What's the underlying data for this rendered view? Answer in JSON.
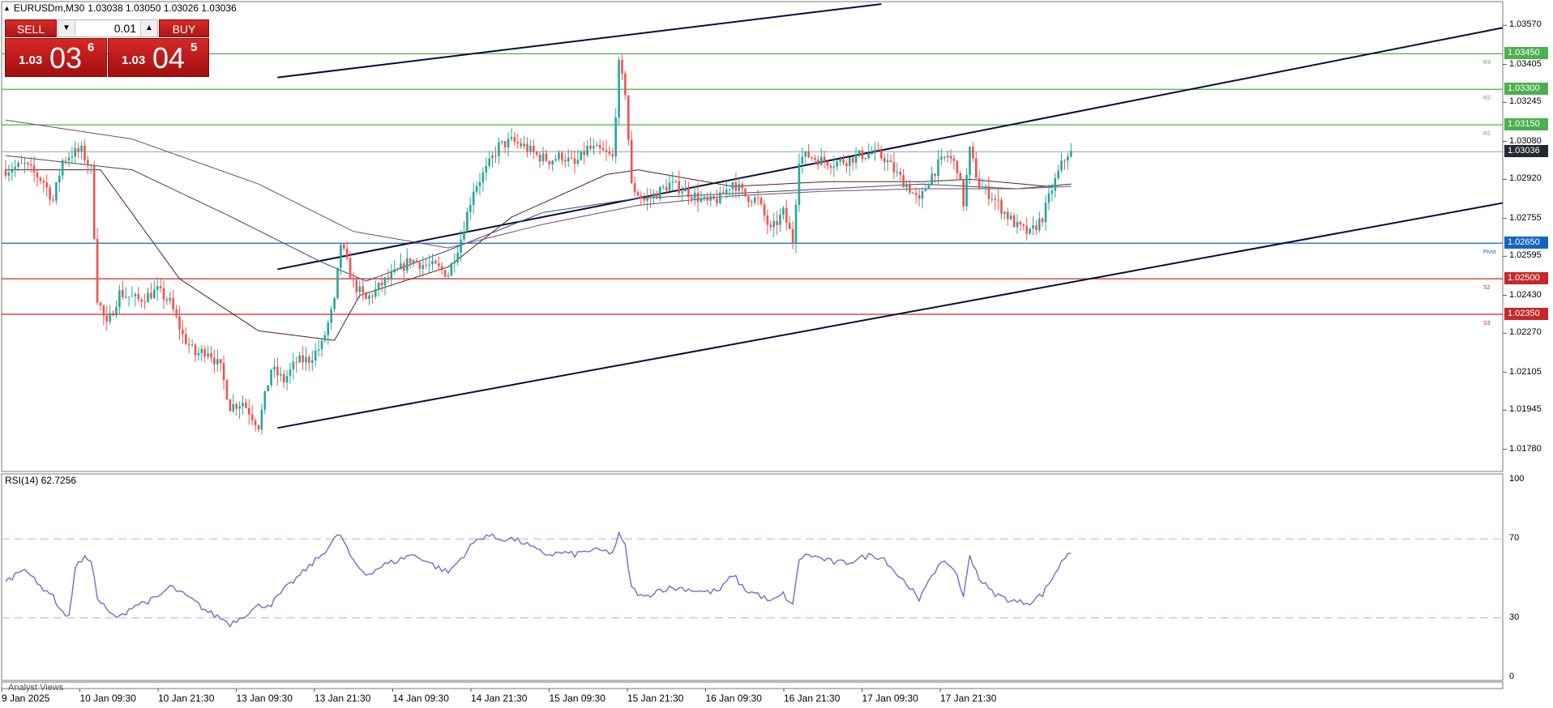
{
  "header": {
    "symbol": "EURUSDm,M30",
    "ohlc": "1.03038 1.03050 1.03026 1.03036"
  },
  "trade_panel": {
    "sell_label": "SELL",
    "buy_label": "BUY",
    "lot": "0.01",
    "sell_small": "1.03",
    "sell_big": "03",
    "sell_sup": "6",
    "buy_small": "1.03",
    "buy_big": "04",
    "buy_sup": "5",
    "arrow_down": "▼",
    "arrow_up": "▲"
  },
  "chart_data": [
    {
      "type": "candlestick",
      "title": "EURUSDm,M30",
      "ylim": [
        1.017,
        1.0366
      ],
      "y_ticks": [
        "1.03570",
        "1.03405",
        "1.03245",
        "1.03080",
        "1.02920",
        "1.02755",
        "1.02595",
        "1.02430",
        "1.02270",
        "1.02105",
        "1.01945",
        "1.01780"
      ],
      "x_ticks": [
        "9 Jan 2025",
        "10 Jan 09:30",
        "10 Jan 21:30",
        "13 Jan 09:30",
        "13 Jan 21:30",
        "14 Jan 09:30",
        "14 Jan 21:30",
        "15 Jan 09:30",
        "15 Jan 21:30",
        "16 Jan 09:30",
        "16 Jan 21:30",
        "17 Jan 09:30",
        "17 Jan 21:30"
      ],
      "current_price": "1.03036",
      "levels": [
        {
          "label": "R3",
          "value": "1.03450",
          "color": "#4caf50"
        },
        {
          "label": "R2",
          "value": "1.03300",
          "color": "#4caf50"
        },
        {
          "label": "R1",
          "value": "1.03150",
          "color": "#4caf50"
        },
        {
          "label": "Pivot",
          "value": "1.02650",
          "color": "#1565c0"
        },
        {
          "label": "S2",
          "value": "1.02500",
          "color": "#c62828"
        },
        {
          "label": "S3",
          "value": "1.02350",
          "color": "#c62828"
        }
      ],
      "close_anchors": [
        [
          0,
          1.0296
        ],
        [
          6,
          1.0298
        ],
        [
          12,
          1.0291
        ],
        [
          15,
          1.0283
        ],
        [
          18,
          1.03
        ],
        [
          21,
          1.0303
        ],
        [
          24,
          1.0304
        ],
        [
          27,
          1.0296
        ],
        [
          29,
          1.0242
        ],
        [
          32,
          1.023
        ],
        [
          36,
          1.0244
        ],
        [
          42,
          1.0241
        ],
        [
          48,
          1.0245
        ],
        [
          52,
          1.024
        ],
        [
          56,
          1.0226
        ],
        [
          60,
          1.0218
        ],
        [
          64,
          1.022
        ],
        [
          68,
          1.0212
        ],
        [
          71,
          1.0196
        ],
        [
          75,
          1.0198
        ],
        [
          80,
          1.0188
        ],
        [
          84,
          1.0212
        ],
        [
          88,
          1.0207
        ],
        [
          92,
          1.0215
        ],
        [
          96,
          1.0216
        ],
        [
          100,
          1.0222
        ],
        [
          104,
          1.024
        ],
        [
          106,
          1.0265
        ],
        [
          110,
          1.0248
        ],
        [
          114,
          1.0241
        ],
        [
          120,
          1.0249
        ],
        [
          124,
          1.0253
        ],
        [
          128,
          1.0258
        ],
        [
          132,
          1.0256
        ],
        [
          136,
          1.0255
        ],
        [
          140,
          1.0252
        ],
        [
          144,
          1.0267
        ],
        [
          148,
          1.0288
        ],
        [
          152,
          1.0296
        ],
        [
          156,
          1.0306
        ],
        [
          160,
          1.0308
        ],
        [
          164,
          1.0306
        ],
        [
          168,
          1.0302
        ],
        [
          172,
          1.03
        ],
        [
          176,
          1.0302
        ],
        [
          180,
          1.0298
        ],
        [
          184,
          1.0305
        ],
        [
          188,
          1.0304
        ],
        [
          192,
          1.0301
        ],
        [
          194,
          1.034
        ],
        [
          196,
          1.0329
        ],
        [
          198,
          1.0289
        ],
        [
          202,
          1.0283
        ],
        [
          206,
          1.0286
        ],
        [
          210,
          1.029
        ],
        [
          214,
          1.0288
        ],
        [
          218,
          1.0285
        ],
        [
          222,
          1.0282
        ],
        [
          226,
          1.0284
        ],
        [
          230,
          1.0291
        ],
        [
          234,
          1.0285
        ],
        [
          238,
          1.0283
        ],
        [
          242,
          1.027
        ],
        [
          246,
          1.0278
        ],
        [
          249,
          1.0266
        ],
        [
          251,
          1.0301
        ],
        [
          254,
          1.0302
        ],
        [
          258,
          1.03
        ],
        [
          262,
          1.0299
        ],
        [
          266,
          1.03
        ],
        [
          270,
          1.0302
        ],
        [
          274,
          1.0303
        ],
        [
          278,
          1.0301
        ],
        [
          282,
          1.0294
        ],
        [
          286,
          1.0288
        ],
        [
          289,
          1.0282
        ],
        [
          292,
          1.0292
        ],
        [
          295,
          1.0298
        ],
        [
          298,
          1.0302
        ],
        [
          301,
          1.0297
        ],
        [
          303,
          1.0282
        ],
        [
          305,
          1.0304
        ],
        [
          308,
          1.0289
        ],
        [
          312,
          1.0285
        ],
        [
          316,
          1.0278
        ],
        [
          320,
          1.0272
        ],
        [
          324,
          1.0269
        ],
        [
          328,
          1.0276
        ],
        [
          331,
          1.0288
        ],
        [
          334,
          1.0298
        ],
        [
          336,
          1.0303
        ],
        [
          337,
          1.0303
        ]
      ],
      "ma_fast_anchors": [
        [
          0,
          1.0296
        ],
        [
          30,
          1.0296
        ],
        [
          55,
          1.025
        ],
        [
          80,
          1.0228
        ],
        [
          104,
          1.0224
        ],
        [
          112,
          1.0243
        ],
        [
          140,
          1.0255
        ],
        [
          160,
          1.0276
        ],
        [
          190,
          1.0294
        ],
        [
          200,
          1.0296
        ],
        [
          230,
          1.0289
        ],
        [
          260,
          1.0291
        ],
        [
          290,
          1.0291
        ],
        [
          305,
          1.0292
        ],
        [
          330,
          1.0289
        ],
        [
          337,
          1.029
        ]
      ],
      "ma_mid_anchors": [
        [
          0,
          1.0302
        ],
        [
          40,
          1.0296
        ],
        [
          70,
          1.0277
        ],
        [
          100,
          1.0257
        ],
        [
          114,
          1.0249
        ],
        [
          140,
          1.0262
        ],
        [
          170,
          1.0278
        ],
        [
          200,
          1.0284
        ],
        [
          230,
          1.0286
        ],
        [
          260,
          1.0288
        ],
        [
          290,
          1.029
        ],
        [
          320,
          1.0288
        ],
        [
          337,
          1.029
        ]
      ],
      "ma_slow_anchors": [
        [
          0,
          1.0317
        ],
        [
          40,
          1.0309
        ],
        [
          80,
          1.029
        ],
        [
          110,
          1.027
        ],
        [
          140,
          1.0263
        ],
        [
          170,
          1.0273
        ],
        [
          200,
          1.0281
        ],
        [
          230,
          1.0285
        ],
        [
          260,
          1.0287
        ],
        [
          290,
          1.0288
        ],
        [
          320,
          1.0288
        ],
        [
          337,
          1.0289
        ]
      ],
      "trendlines": [
        {
          "from": [
            86,
            1.0335
          ],
          "to": [
            277,
            1.0366
          ]
        },
        {
          "from": [
            86,
            1.0254
          ],
          "to": [
            510,
            1.0356
          ]
        },
        {
          "from": [
            86,
            1.0187
          ],
          "to": [
            510,
            1.0282
          ]
        }
      ]
    },
    {
      "type": "line",
      "title": "RSI(14) 62.7256",
      "ylim": [
        0,
        100
      ],
      "y_ticks": [
        "100",
        "70",
        "30",
        "0"
      ],
      "levels": [
        70,
        30
      ],
      "value_anchors": [
        [
          0,
          48
        ],
        [
          6,
          56
        ],
        [
          10,
          47
        ],
        [
          14,
          43
        ],
        [
          18,
          33
        ],
        [
          20,
          30
        ],
        [
          22,
          56
        ],
        [
          25,
          60
        ],
        [
          27,
          60
        ],
        [
          29,
          40
        ],
        [
          33,
          32
        ],
        [
          36,
          30
        ],
        [
          40,
          36
        ],
        [
          44,
          38
        ],
        [
          48,
          40
        ],
        [
          52,
          46
        ],
        [
          56,
          42
        ],
        [
          60,
          38
        ],
        [
          64,
          33
        ],
        [
          68,
          30
        ],
        [
          71,
          27
        ],
        [
          75,
          31
        ],
        [
          80,
          36
        ],
        [
          84,
          37
        ],
        [
          88,
          44
        ],
        [
          92,
          50
        ],
        [
          96,
          56
        ],
        [
          100,
          62
        ],
        [
          104,
          70
        ],
        [
          106,
          72
        ],
        [
          110,
          58
        ],
        [
          114,
          52
        ],
        [
          120,
          57
        ],
        [
          124,
          59
        ],
        [
          128,
          62
        ],
        [
          132,
          60
        ],
        [
          136,
          56
        ],
        [
          140,
          53
        ],
        [
          144,
          60
        ],
        [
          148,
          68
        ],
        [
          152,
          72
        ],
        [
          156,
          70
        ],
        [
          160,
          70
        ],
        [
          164,
          68
        ],
        [
          168,
          64
        ],
        [
          172,
          62
        ],
        [
          176,
          63
        ],
        [
          180,
          62
        ],
        [
          184,
          64
        ],
        [
          188,
          64
        ],
        [
          192,
          63
        ],
        [
          194,
          72
        ],
        [
          196,
          66
        ],
        [
          198,
          45
        ],
        [
          202,
          40
        ],
        [
          206,
          44
        ],
        [
          210,
          45
        ],
        [
          214,
          45
        ],
        [
          218,
          44
        ],
        [
          222,
          43
        ],
        [
          226,
          44
        ],
        [
          230,
          52
        ],
        [
          234,
          44
        ],
        [
          238,
          42
        ],
        [
          242,
          38
        ],
        [
          246,
          42
        ],
        [
          249,
          36
        ],
        [
          251,
          60
        ],
        [
          254,
          62
        ],
        [
          258,
          60
        ],
        [
          262,
          58
        ],
        [
          266,
          58
        ],
        [
          270,
          60
        ],
        [
          274,
          62
        ],
        [
          278,
          60
        ],
        [
          282,
          52
        ],
        [
          286,
          46
        ],
        [
          289,
          38
        ],
        [
          292,
          50
        ],
        [
          295,
          56
        ],
        [
          298,
          58
        ],
        [
          301,
          52
        ],
        [
          303,
          40
        ],
        [
          305,
          62
        ],
        [
          308,
          50
        ],
        [
          312,
          43
        ],
        [
          316,
          40
        ],
        [
          320,
          38
        ],
        [
          324,
          38
        ],
        [
          328,
          42
        ],
        [
          331,
          50
        ],
        [
          334,
          58
        ],
        [
          336,
          63
        ],
        [
          337,
          62.7
        ]
      ]
    }
  ],
  "rsi_title": "RSI(14) 62.7256",
  "analyst_label": "Analyst Views",
  "colors": {
    "bull": "#26a69a",
    "bear": "#ef5350",
    "ma_fast": "#5a1e1e",
    "ma_mid": "#3a4a7a",
    "ma_slow": "#7a4a6a",
    "rsi": "#7b68c9",
    "trend": "#0b0b3a"
  }
}
